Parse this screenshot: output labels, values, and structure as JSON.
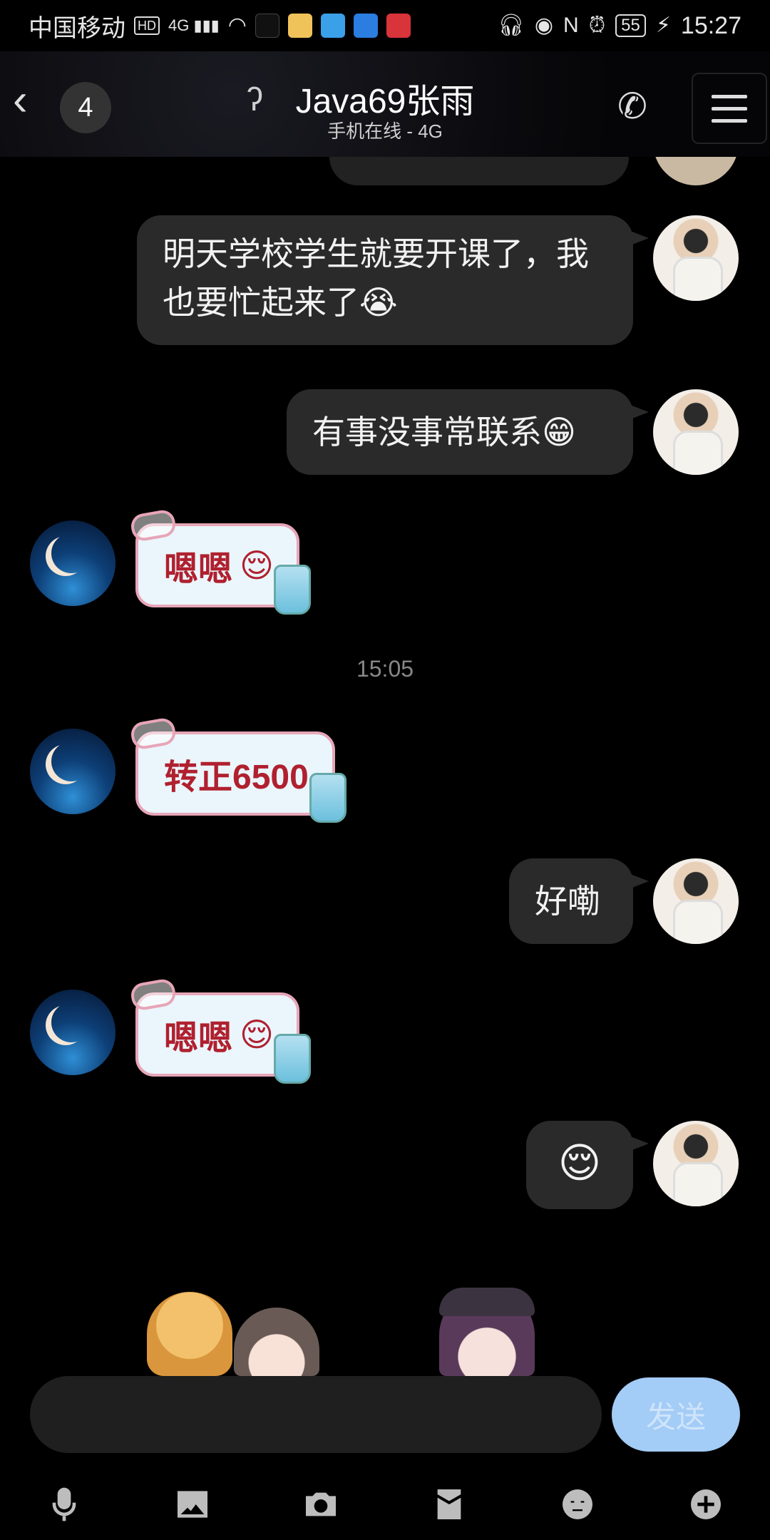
{
  "status_bar": {
    "carrier": "中国移动",
    "hd": "HD",
    "network": "4G",
    "battery": "55",
    "time": "15:27"
  },
  "header": {
    "unread_count": "4",
    "title": "Java69张雨",
    "subtitle": "手机在线 - 4G"
  },
  "messages": [
    {
      "side": "out",
      "text": "明天学校学生就要开课了，我也要忙起来了",
      "emoji": "😭"
    },
    {
      "side": "out",
      "text": "有事没事常联系",
      "emoji": "😁"
    },
    {
      "side": "in",
      "sticker_text": "嗯嗯",
      "emoji": "😌"
    },
    {
      "timestamp": "15:05"
    },
    {
      "side": "in",
      "sticker_text": "转正6500"
    },
    {
      "side": "out",
      "text": "好嘞"
    },
    {
      "side": "in",
      "sticker_text": "嗯嗯",
      "emoji": "😌"
    },
    {
      "side": "out",
      "emoji": "😌"
    }
  ],
  "input": {
    "value": "",
    "send_label": "发送"
  },
  "toolbar": {
    "items": [
      "mic-icon",
      "image-icon",
      "camera-icon",
      "red-packet-icon",
      "emoji-icon",
      "plus-icon"
    ]
  },
  "colors": {
    "background": "#000000",
    "bubble_out": "#2a2a2a",
    "send_button": "#a3ccf6",
    "sticker_text": "#b0202f"
  }
}
